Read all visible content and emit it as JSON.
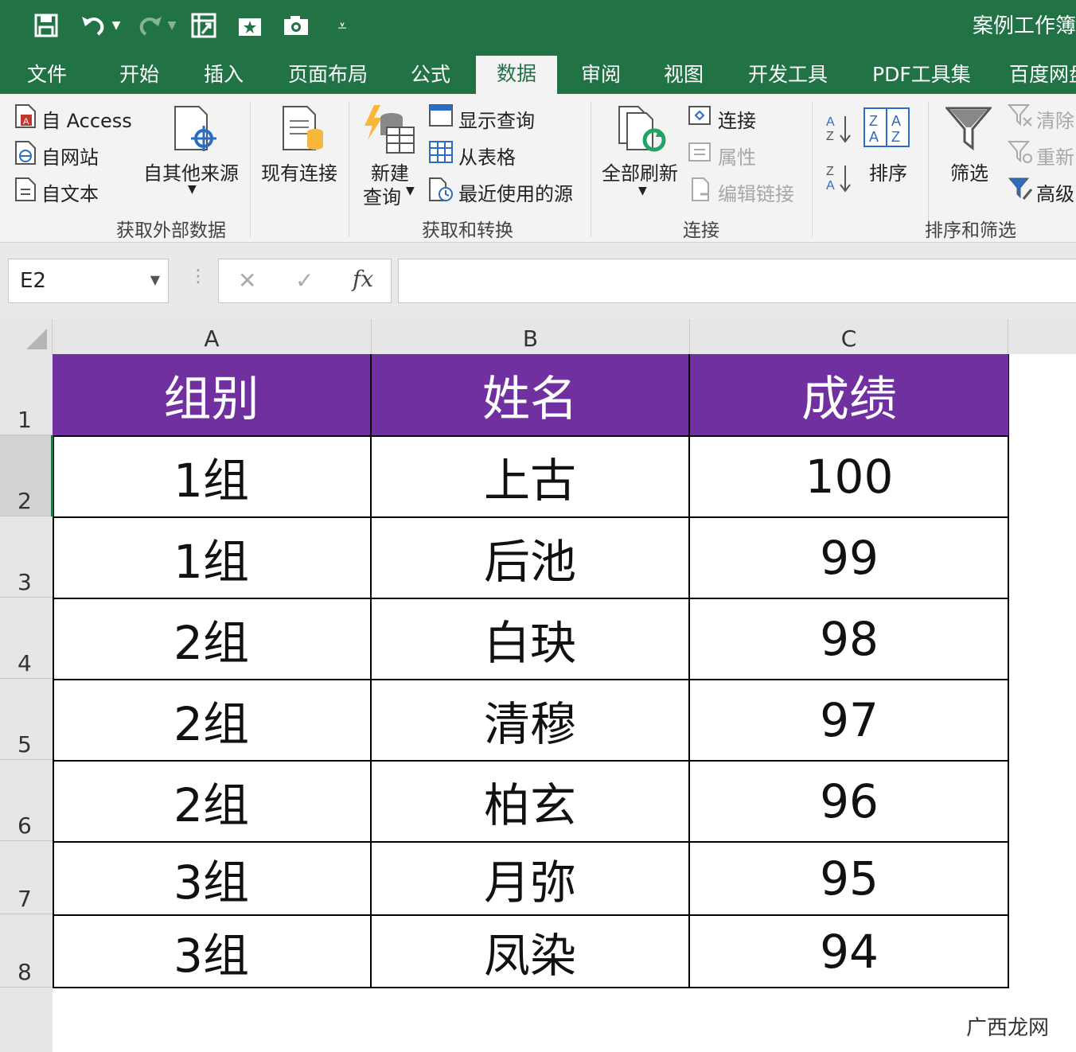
{
  "title_bar": {
    "title": "案例工作簿"
  },
  "tabs": [
    "文件",
    "开始",
    "插入",
    "页面布局",
    "公式",
    "数据",
    "审阅",
    "视图",
    "开发工具",
    "PDF工具集",
    "百度网盘"
  ],
  "active_tab": "数据",
  "ribbon": {
    "get_external": {
      "access": "自 Access",
      "web": "自网站",
      "text": "自文本",
      "other": "自其他来源",
      "existing": "现有连接",
      "group": "获取外部数据"
    },
    "get_transform": {
      "new_query_1": "新建",
      "new_query_2": "查询",
      "show_queries": "显示查询",
      "from_table": "从表格",
      "recent_sources": "最近使用的源",
      "group": "获取和转换"
    },
    "connections": {
      "refresh_all": "全部刷新",
      "connections": "连接",
      "properties": "属性",
      "edit_links": "编辑链接",
      "group": "连接"
    },
    "sort_filter": {
      "sort": "排序",
      "filter": "筛选",
      "clear": "清除",
      "reapply": "重新",
      "advanced": "高级",
      "group": "排序和筛选"
    }
  },
  "formula_bar": {
    "name_box": "E2",
    "formula": ""
  },
  "columns": [
    "A",
    "B",
    "C"
  ],
  "rows": [
    "1",
    "2",
    "3",
    "4",
    "5",
    "6",
    "7",
    "8"
  ],
  "table": {
    "header": [
      "组别",
      "姓名",
      "成绩"
    ],
    "data": [
      [
        "1组",
        "上古",
        "100"
      ],
      [
        "1组",
        "后池",
        "99"
      ],
      [
        "2组",
        "白玦",
        "98"
      ],
      [
        "2组",
        "清穆",
        "97"
      ],
      [
        "2组",
        "柏玄",
        "96"
      ],
      [
        "3组",
        "月弥",
        "95"
      ],
      [
        "3组",
        "凤染",
        "94"
      ]
    ]
  },
  "colors": {
    "header_fill": "#7030a0",
    "excel_green": "#217346"
  },
  "watermark": "广西龙网"
}
